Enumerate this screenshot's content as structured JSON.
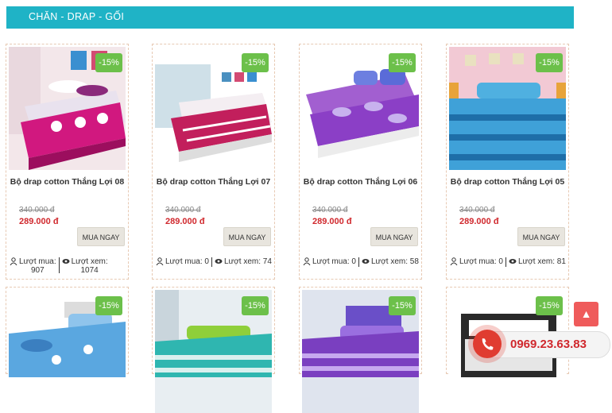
{
  "header": {
    "title": "CHĂN - DRAP - GỐI"
  },
  "products": [
    {
      "title": "Bộ drap cotton Thắng Lợi 08",
      "discount": "-15%",
      "old_price": "340.000 đ",
      "new_price": "289.000 đ",
      "buy_label": "MUA NGAY",
      "buys_label": "Lượt mua:",
      "buys": "907",
      "views_label": "Lượt xem:",
      "views": "1074"
    },
    {
      "title": "Bộ drap cotton Thắng Lợi 07",
      "discount": "-15%",
      "old_price": "340.000 đ",
      "new_price": "289.000 đ",
      "buy_label": "MUA NGAY",
      "buys_label": "Lượt mua:",
      "buys": "0",
      "views_label": "Lượt xem:",
      "views": "74"
    },
    {
      "title": "Bộ drap cotton Thắng Lợi 06",
      "discount": "-15%",
      "old_price": "340.000 đ",
      "new_price": "289.000 đ",
      "buy_label": "MUA NGAY",
      "buys_label": "Lượt mua:",
      "buys": "0",
      "views_label": "Lượt xem:",
      "views": "58"
    },
    {
      "title": "Bộ drap cotton Thắng Lợi 05",
      "discount": "-15%",
      "old_price": "340.000 đ",
      "new_price": "289.000 đ",
      "buy_label": "MUA NGAY",
      "buys_label": "Lượt mua:",
      "buys": "0",
      "views_label": "Lượt xem:",
      "views": "81"
    },
    {
      "discount": "-15%"
    },
    {
      "discount": "-15%"
    },
    {
      "discount": "-15%"
    },
    {
      "discount": "-15%"
    }
  ],
  "scroll_top_icon": "arrow-up-icon",
  "hotline": {
    "number": "0969.23.63.83",
    "icon": "phone-icon"
  },
  "colors": {
    "header": "#1fb3c6",
    "badge": "#6cc04a",
    "price": "#d0282d",
    "hotline": "#e03c31"
  }
}
